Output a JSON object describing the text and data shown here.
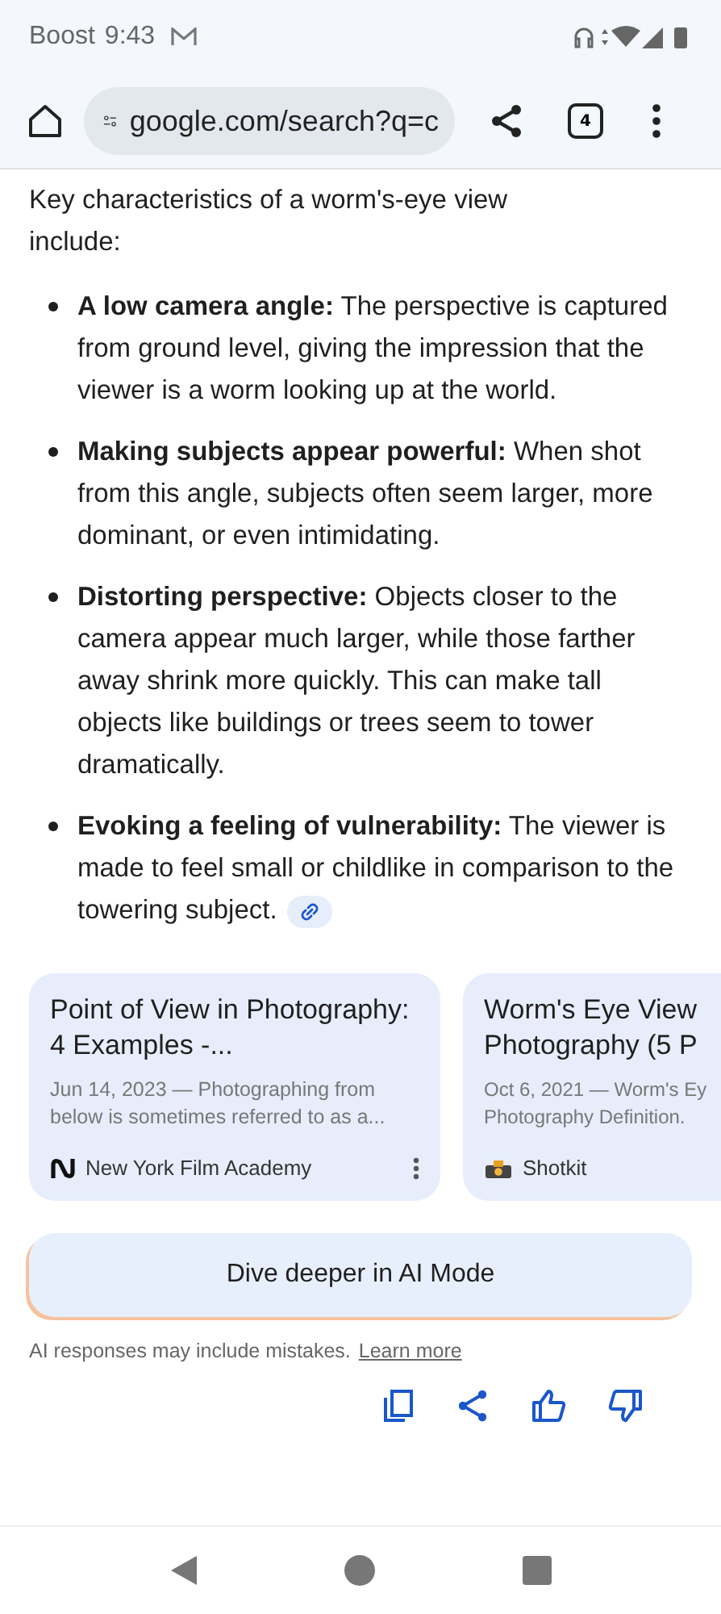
{
  "status_bar": {
    "carrier": "Boost",
    "time": "9:43"
  },
  "toolbar": {
    "url": "google.com/search?q=c",
    "tab_count": "4"
  },
  "intro": "Key characteristics of a worm's-eye view include:",
  "bullets": [
    {
      "text": "**A low camera angle:** The perspective is captured from ground level, giving the impression that the viewer is a worm looking up at the world.",
      "link": false
    },
    {
      "text": "**Making subjects appear powerful:** When shot from this angle, subjects often seem larger, more dominant, or even intimidating.",
      "link": false
    },
    {
      "text": "**Distorting perspective:** Objects closer to the camera appear much larger, while those farther away shrink more quickly. This can make tall objects like buildings or trees seem to tower dramatically.",
      "link": false
    },
    {
      "text": "**Evoking a feeling of vulnerability:** The viewer is made to feel small or childlike in comparison to the towering subject.",
      "link": true
    }
  ],
  "sources": [
    {
      "title": "Point of View in Photography: 4 Examples -...",
      "snippet": "Jun 14, 2023 — Photographing from below is sometimes referred to as a...",
      "site": "New York Film Academy",
      "kind": "letter",
      "menu": true
    },
    {
      "title": "Worm's Eye View Photography (5 P",
      "snippet": "Oct 6, 2021 — Worm's Ey Photography Definition.",
      "site": "Shotkit",
      "kind": "camera",
      "menu": false
    }
  ],
  "ai_button": "Dive deeper in AI Mode",
  "disclaimer": "AI responses may include mistakes.",
  "learn_more": "Learn more"
}
